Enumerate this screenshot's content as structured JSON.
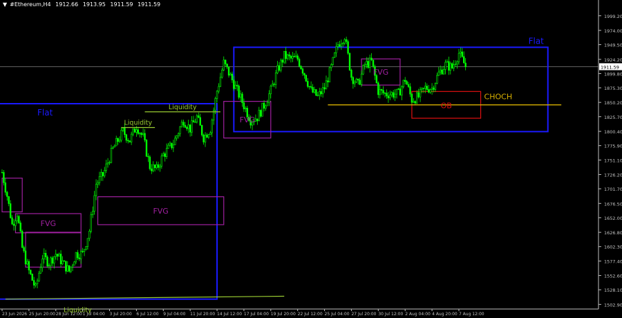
{
  "header": {
    "symbol": "#Ethereum,H4",
    "open": "1912.66",
    "high": "1913.95",
    "low": "1911.59",
    "close": "1911.59"
  },
  "colors": {
    "background": "#000000",
    "candle": "#00ff00",
    "axis": "#c0c0c0",
    "flat_box": "#1a1aff",
    "fvg_box": "#a020a0",
    "ob_box": "#e01010",
    "choch_line": "#d8b000",
    "liquidity_line": "#9acd32",
    "price_line": "#808080"
  },
  "chart_data": {
    "type": "candlestick",
    "symbol": "#Ethereum",
    "timeframe": "H4",
    "current_price": 1911.59,
    "ylim": [
      1495,
      2012
    ],
    "y_ticks": [
      "1999.20",
      "1974.00",
      "1949.50",
      "1924.20",
      "1899.80",
      "1875.30",
      "1850.20",
      "1825.70",
      "1800.40",
      "1775.90",
      "1751.10",
      "1726.20",
      "1701.70",
      "1676.50",
      "1652.00",
      "1626.80",
      "1602.30",
      "1577.40",
      "1552.60",
      "1528.10",
      "1502.90"
    ],
    "x_ticks": [
      "23 Jun 2026",
      "25 Jun 20:00",
      "28 Jun 12:00",
      "1 Jul 04:00",
      "3 Jul 20:00",
      "6 Jul 12:00",
      "9 Jul 04:00",
      "11 Jul 20:00",
      "14 Jul 12:00",
      "17 Jul 04:00",
      "19 Jul 20:00",
      "22 Jul 12:00",
      "25 Jul 04:00",
      "27 Jul 20:00",
      "30 Jul 12:00",
      "2 Aug 04:00",
      "4 Aug 20:00",
      "7 Aug 12:00"
    ],
    "x_tick_values": [
      0,
      16,
      32,
      48,
      64,
      80,
      96,
      112,
      128,
      144,
      160,
      176,
      192,
      208,
      224,
      240,
      256,
      272
    ],
    "price_path": [
      [
        0,
        1730
      ],
      [
        3,
        1690
      ],
      [
        6,
        1640
      ],
      [
        9,
        1660
      ],
      [
        12,
        1600
      ],
      [
        16,
        1560
      ],
      [
        20,
        1530
      ],
      [
        24,
        1585
      ],
      [
        28,
        1575
      ],
      [
        32,
        1590
      ],
      [
        36,
        1575
      ],
      [
        40,
        1560
      ],
      [
        44,
        1590
      ],
      [
        48,
        1590
      ],
      [
        52,
        1630
      ],
      [
        56,
        1710
      ],
      [
        60,
        1725
      ],
      [
        66,
        1770
      ],
      [
        72,
        1800
      ],
      [
        76,
        1785
      ],
      [
        80,
        1810
      ],
      [
        84,
        1790
      ],
      [
        88,
        1740
      ],
      [
        92,
        1735
      ],
      [
        96,
        1760
      ],
      [
        102,
        1780
      ],
      [
        108,
        1820
      ],
      [
        112,
        1805
      ],
      [
        116,
        1825
      ],
      [
        120,
        1790
      ],
      [
        124,
        1805
      ],
      [
        128,
        1870
      ],
      [
        132,
        1918
      ],
      [
        136,
        1895
      ],
      [
        140,
        1870
      ],
      [
        144,
        1845
      ],
      [
        148,
        1820
      ],
      [
        152,
        1825
      ],
      [
        156,
        1845
      ],
      [
        160,
        1870
      ],
      [
        164,
        1905
      ],
      [
        168,
        1930
      ],
      [
        172,
        1925
      ],
      [
        176,
        1925
      ],
      [
        180,
        1900
      ],
      [
        184,
        1870
      ],
      [
        188,
        1860
      ],
      [
        192,
        1875
      ],
      [
        196,
        1910
      ],
      [
        200,
        1950
      ],
      [
        204,
        1965
      ],
      [
        206,
        1930
      ],
      [
        208,
        1895
      ],
      [
        212,
        1880
      ],
      [
        216,
        1915
      ],
      [
        220,
        1920
      ],
      [
        224,
        1870
      ],
      [
        228,
        1865
      ],
      [
        232,
        1865
      ],
      [
        236,
        1865
      ],
      [
        240,
        1890
      ],
      [
        244,
        1855
      ],
      [
        248,
        1860
      ],
      [
        252,
        1875
      ],
      [
        256,
        1875
      ],
      [
        260,
        1900
      ],
      [
        264,
        1915
      ],
      [
        268,
        1910
      ],
      [
        272,
        1935
      ],
      [
        276,
        1912
      ]
    ],
    "annotations": [
      {
        "kind": "box",
        "label": "Flat",
        "style": "flat",
        "x0": -2,
        "x1": 128,
        "y0": 1512,
        "y1": 1848
      },
      {
        "kind": "box",
        "label": "Flat",
        "style": "flat",
        "x0": 138,
        "x1": 325,
        "y0": 1800,
        "y1": 1945
      },
      {
        "kind": "box",
        "label": "FVG",
        "style": "fvg",
        "x0": 8,
        "x1": 47,
        "y0": 1626,
        "y1": 1659
      },
      {
        "kind": "box",
        "label": "",
        "style": "fvg",
        "x0": 0,
        "x1": 12,
        "y0": 1662,
        "y1": 1720
      },
      {
        "kind": "box",
        "label": "",
        "style": "fvg",
        "x0": 14,
        "x1": 47,
        "y0": 1567,
        "y1": 1627
      },
      {
        "kind": "box",
        "label": "FVG",
        "style": "fvg",
        "x0": 57,
        "x1": 132,
        "y0": 1640,
        "y1": 1688
      },
      {
        "kind": "box",
        "label": "FVG",
        "style": "fvg",
        "x0": 132,
        "x1": 160,
        "y0": 1789,
        "y1": 1852
      },
      {
        "kind": "box",
        "label": "FVG",
        "style": "fvg",
        "x0": 214,
        "x1": 237,
        "y0": 1880,
        "y1": 1925
      },
      {
        "kind": "box",
        "label": "OB",
        "style": "ob",
        "x0": 244,
        "x1": 285,
        "y0": 1823,
        "y1": 1869
      },
      {
        "kind": "line",
        "label": "CHOCH",
        "style": "choch",
        "x0": 194,
        "x1": 333,
        "y0": 1846,
        "y1": 1846
      },
      {
        "kind": "line",
        "label": "Liquidity",
        "style": "liq",
        "x0": 2,
        "x1": 168,
        "y0": 1512,
        "y1": 1517
      },
      {
        "kind": "line",
        "label": "Liquidity",
        "style": "liq",
        "x0": 71,
        "x1": 91,
        "y0": 1807,
        "y1": 1807
      },
      {
        "kind": "line",
        "label": "Liquidity",
        "style": "liq",
        "x0": 85,
        "x1": 130,
        "y0": 1834,
        "y1": 1834
      }
    ]
  }
}
